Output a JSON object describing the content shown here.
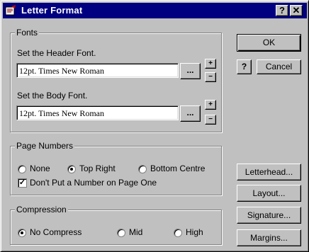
{
  "window": {
    "title": "Letter Format",
    "help_label": "?",
    "close_label": "✕"
  },
  "fonts_group": {
    "legend": "Fonts",
    "header_label": "Set the Header Font.",
    "header_value": "12pt. Times New Roman",
    "body_label": "Set the Body Font.",
    "body_value": "12pt. Times New Roman",
    "browse_label": "...",
    "plus_label": "+",
    "minus_label": "−"
  },
  "page_numbers_group": {
    "legend": "Page Numbers",
    "options": [
      "None",
      "Top Right",
      "Bottom Centre"
    ],
    "selected": "Top Right",
    "checkbox_label": "Don't Put a Number on Page One",
    "checkbox_checked": true
  },
  "compression_group": {
    "legend": "Compression",
    "options": [
      "No Compress",
      "Mid",
      "High"
    ],
    "selected": "No Compress"
  },
  "buttons": {
    "ok": "OK",
    "help": "?",
    "cancel": "Cancel",
    "letterhead": "Letterhead...",
    "layout": "Layout...",
    "signature": "Signature...",
    "margins": "Margins..."
  }
}
